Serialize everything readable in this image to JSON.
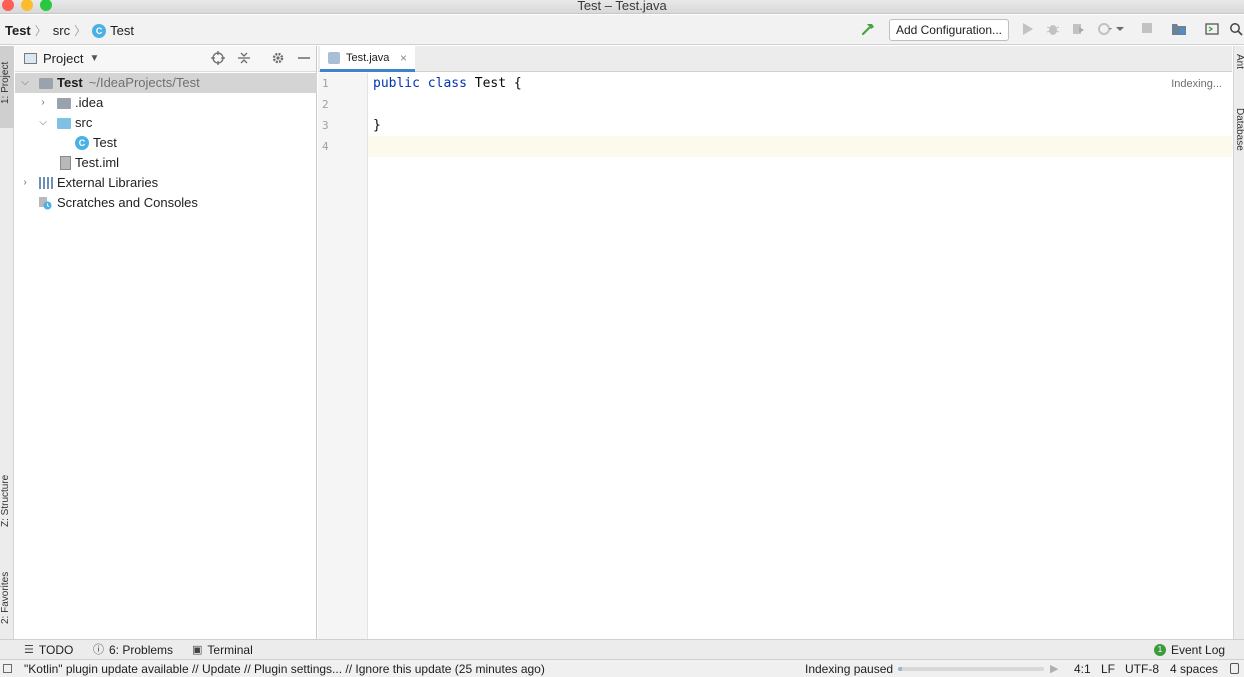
{
  "window": {
    "title": "Test – Test.java"
  },
  "navbar": {
    "crumbs": [
      "Test",
      "src",
      "Test"
    ],
    "class_badge": "C",
    "add_config_label": "Add Configuration..."
  },
  "left_stripe": {
    "project_tab": "1: Project",
    "structure_tab": "Z: Structure",
    "favorites_tab": "2: Favorites"
  },
  "project_panel": {
    "title": "Project",
    "tree": [
      {
        "label": "Test",
        "sub": "~/IdeaProjects/Test"
      },
      {
        "label": ".idea"
      },
      {
        "label": "src"
      },
      {
        "label": "Test"
      },
      {
        "label": "Test.iml"
      },
      {
        "label": "External Libraries"
      },
      {
        "label": "Scratches and Consoles"
      }
    ]
  },
  "editor": {
    "tab_label": "Test.java",
    "tab_close": "×",
    "line_numbers": [
      "1",
      "2",
      "3",
      "4"
    ],
    "code": {
      "kw1": "public",
      "kw2": "class",
      "line1_rest": " Test {",
      "line3": "}"
    },
    "indexing_label": "Indexing..."
  },
  "right_stripe": {
    "ant_tab": "Ant",
    "database_tab": "Database"
  },
  "bottom_tools": {
    "todo": "TODO",
    "problems": "6: Problems",
    "terminal": "Terminal",
    "event_log": "Event Log",
    "event_badge": "1"
  },
  "statusbar": {
    "message": "\"Kotlin\" plugin update available // Update // Plugin settings... // Ignore this update (25 minutes ago)",
    "indexing_paused": "Indexing paused",
    "indexing_progress": 0.03,
    "position": "4:1",
    "line_sep": "LF",
    "encoding": "UTF-8",
    "indent": "4 spaces"
  },
  "colors": {
    "accent": "#4083c9",
    "keyword": "#0033b3",
    "class_icon": "#49b1e4",
    "build_green": "#4aa243"
  },
  "icons": {
    "build": "hammer-icon",
    "run": "run-icon",
    "debug": "debug-icon",
    "coverage": "coverage-icon",
    "profile": "profile-icon",
    "stop": "stop-icon",
    "project_structure": "project-structure-icon",
    "layout": "layout-icon",
    "search": "search-icon"
  }
}
